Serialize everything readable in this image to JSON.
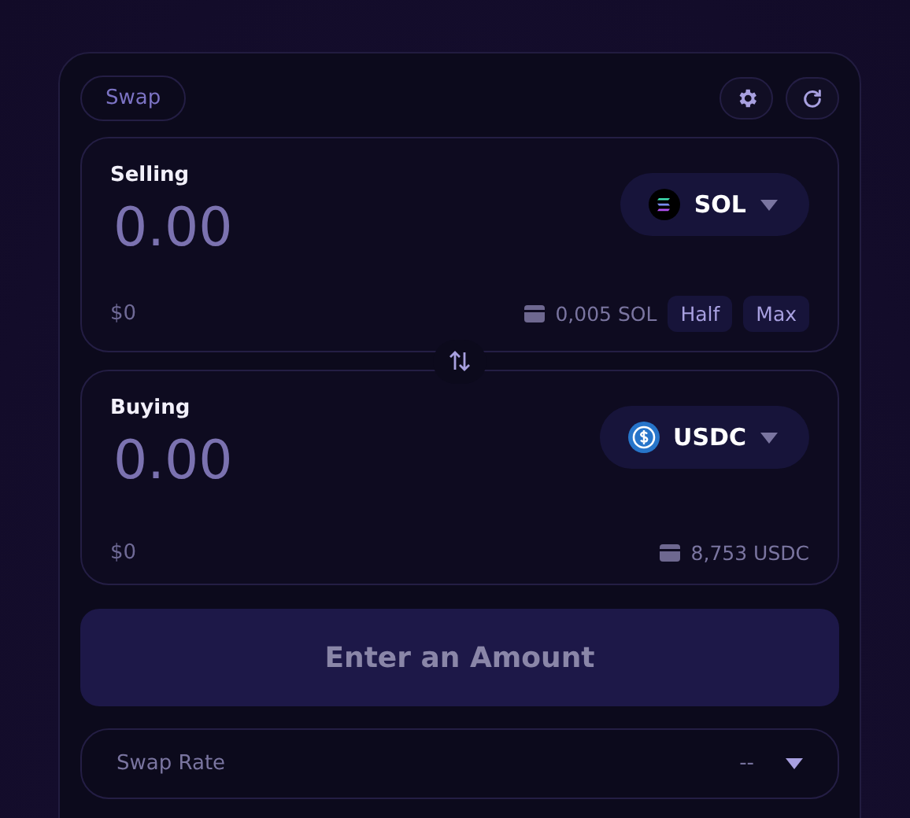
{
  "header": {
    "tab": "Swap"
  },
  "panels": [
    {
      "label": "Selling",
      "amount": "0.00",
      "usd": "$0",
      "token": "SOL",
      "balance": "0,005 SOL",
      "actions": [
        "Half",
        "Max"
      ]
    },
    {
      "label": "Buying",
      "amount": "0.00",
      "usd": "$0",
      "token": "USDC",
      "balance": "8,753 USDC"
    }
  ],
  "submit": {
    "label": "Enter an Amount",
    "disabled": true
  },
  "swap_rate": {
    "label": "Swap Rate",
    "value": "--"
  }
}
